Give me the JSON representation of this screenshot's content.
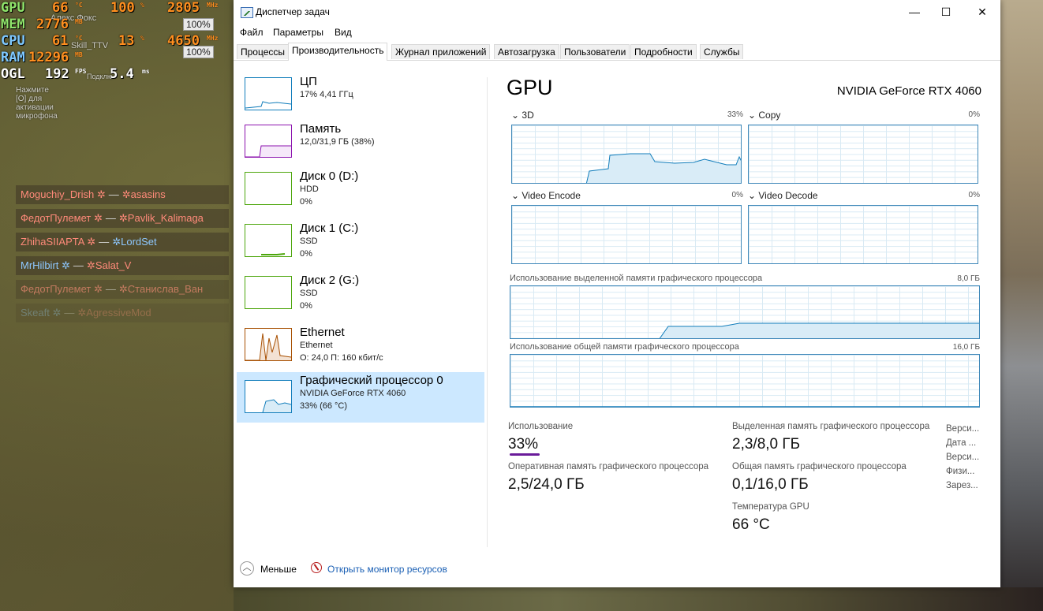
{
  "osd": {
    "gpu": {
      "label": "GPU",
      "temp": "66",
      "temp_unit": "°C",
      "load": "100",
      "load_unit": "%",
      "clock": "2805",
      "clock_unit": "MHz"
    },
    "mem": {
      "label": "MEM",
      "value": "2776",
      "unit": "MB"
    },
    "cpu": {
      "label": "CPU",
      "temp": "61",
      "temp_unit": "°C",
      "load": "13",
      "load_unit": "%",
      "clock": "4650",
      "clock_unit": "MHz"
    },
    "ram": {
      "label": "RAM",
      "value": "12296",
      "unit": "MB"
    },
    "ogl": {
      "label": "OGL",
      "fps": "192",
      "fps_unit": "FPS",
      "frametime": "5.4",
      "frametime_unit": "ms"
    },
    "overlay_user1": "Алекс Фокс",
    "overlay_user2": "Skill_TTV",
    "vol1": "100%",
    "vol2": "100%",
    "overlay_connect": "Подклю",
    "mic_hint": "Нажмите [O] для активации микрофона"
  },
  "killfeed": [
    {
      "killer": "Moguchiy_Drish",
      "victim": "asasins",
      "killer_team": "red",
      "victim_team": "red"
    },
    {
      "killer": "ФедотПулемет",
      "victim": "Pavlik_Kalimaga",
      "killer_team": "red",
      "victim_team": "red"
    },
    {
      "killer": "ZhihaSIIAPTA",
      "victim": "LordSet",
      "killer_team": "red",
      "victim_team": "blue"
    },
    {
      "killer": "MrHilbirt",
      "victim": "Salat_V",
      "killer_team": "blue",
      "victim_team": "red"
    },
    {
      "killer": "ФедотПулемет",
      "victim": "Станислав_Ван",
      "killer_team": "red",
      "victim_team": "red"
    },
    {
      "killer": "Skeaft",
      "victim": "AgressiveMod",
      "killer_team": "blue",
      "victim_team": "red"
    }
  ],
  "window": {
    "title": "Диспетчер задач",
    "controls": {
      "minimize": "—",
      "maximize": "☐",
      "close": "✕"
    },
    "menu": [
      "Файл",
      "Параметры",
      "Вид"
    ],
    "tabs": [
      "Процессы",
      "Производительность",
      "Журнал приложений",
      "Автозагрузка",
      "Пользователи",
      "Подробности",
      "Службы"
    ],
    "active_tab": "Производительность"
  },
  "sidebar": [
    {
      "title": "ЦП",
      "sub1": "17% 4,41 ГГц",
      "sub2": "",
      "color": "#117dbb"
    },
    {
      "title": "Память",
      "sub1": "12,0/31,9 ГБ (38%)",
      "sub2": "",
      "color": "#8b12ae"
    },
    {
      "title": "Диск 0 (D:)",
      "sub1": "HDD",
      "sub2": "0%",
      "color": "#4da60c"
    },
    {
      "title": "Диск 1 (C:)",
      "sub1": "SSD",
      "sub2": "0%",
      "color": "#4da60c"
    },
    {
      "title": "Диск 2 (G:)",
      "sub1": "SSD",
      "sub2": "0%",
      "color": "#4da60c"
    },
    {
      "title": "Ethernet",
      "sub1": "Ethernet",
      "sub2": "О: 24,0 П: 160 кбит/с",
      "color": "#a74f01"
    },
    {
      "title": "Графический процессор 0",
      "sub1": "NVIDIA GeForce RTX 4060",
      "sub2": "33% (66 °C)",
      "color": "#117dbb"
    }
  ],
  "gpu": {
    "title": "GPU",
    "name": "NVIDIA GeForce RTX 4060",
    "engines": [
      {
        "label": "3D",
        "pct": "33%"
      },
      {
        "label": "Copy",
        "pct": "0%"
      },
      {
        "label": "Video Encode",
        "pct": "0%"
      },
      {
        "label": "Video Decode",
        "pct": "0%"
      }
    ],
    "dedicated_label": "Использование выделенной памяти графического процессора",
    "dedicated_max": "8,0 ГБ",
    "shared_label": "Использование общей памяти графического процессора",
    "shared_max": "16,0 ГБ",
    "stats": {
      "usage_label": "Использование",
      "usage": "33%",
      "dedicated_label": "Выделенная память графического процессора",
      "dedicated": "2,3/8,0 ГБ",
      "gpu_mem_label": "Оперативная память графического процессора",
      "gpu_mem": "2,5/24,0 ГБ",
      "shared_label": "Общая память графического процессора",
      "shared": "0,1/16,0 ГБ",
      "temp_label": "Температура GPU",
      "temp": "66 °C"
    },
    "side_labels": [
      "Верси...",
      "Дата ...",
      "Верси...",
      "Физи...",
      "Зарез..."
    ]
  },
  "footer": {
    "less": "Меньше",
    "monitor": "Открыть монитор ресурсов"
  },
  "colors": {
    "accent": "#117dbb",
    "selected": "#cce8ff",
    "usage_underline": "#6a1b9a"
  }
}
